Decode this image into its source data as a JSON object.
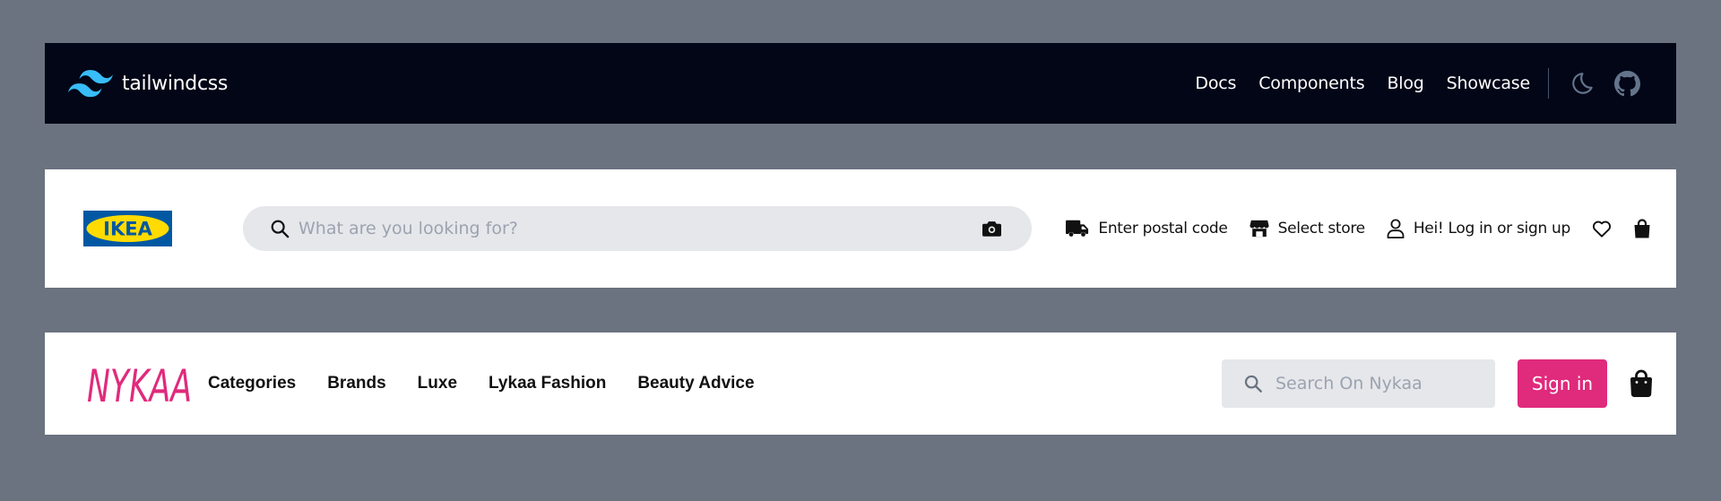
{
  "tailwind_bar": {
    "brand": "tailwindcss",
    "nav": [
      "Docs",
      "Components",
      "Blog",
      "Showcase"
    ],
    "colors": {
      "background": "#020617",
      "logo": "#38bdf8"
    },
    "icons": [
      "tailwind-logo",
      "moon-icon",
      "github-icon"
    ]
  },
  "ikea_bar": {
    "logo_text": "IKEA",
    "search": {
      "placeholder": "What are you looking for?"
    },
    "links": {
      "postal": "Enter postal code",
      "store": "Select store",
      "login": "Hei! Log in or sign up"
    },
    "colors": {
      "logo_blue": "#0058a3",
      "logo_yellow": "#ffdb00"
    },
    "icons": [
      "search-icon",
      "camera-icon",
      "truck-icon",
      "store-icon",
      "user-icon",
      "heart-icon",
      "bag-icon"
    ]
  },
  "nykaa_bar": {
    "logo_text": "NYKAA",
    "nav": [
      "Categories",
      "Brands",
      "Luxe",
      "Lykaa Fashion",
      "Beauty Advice"
    ],
    "search": {
      "placeholder": "Search On Nykaa"
    },
    "signin_label": "Sign in",
    "colors": {
      "brand": "#e02a7c"
    },
    "icons": [
      "search-icon",
      "shopping-bag-icon"
    ]
  }
}
